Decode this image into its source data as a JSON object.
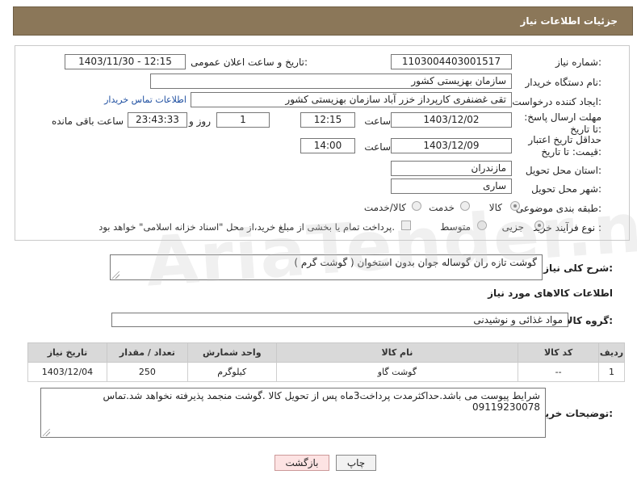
{
  "header": {
    "title": "جزئیات اطلاعات نیاز"
  },
  "form": {
    "need_number_label": "شماره نیاز:",
    "need_number": "1103004403001517",
    "announce_label": "تاریخ و ساعت اعلان عمومی:",
    "announce_value": "1403/11/30 - 12:15",
    "buyer_org_label": "نام دستگاه خریدار:",
    "buyer_org": "سازمان بهزیستی کشور",
    "requester_label": "ایجاد کننده درخواست:",
    "requester": "تقی غضنفری کارپرداز خزر آباد سازمان بهزیستی کشور",
    "contact_link": "اطلاعات تماس خریدار",
    "deadline_label": "مهلت ارسال پاسخ: تا تاریخ:",
    "deadline_date": "1403/12/02",
    "time_label": "ساعت",
    "deadline_time": "12:15",
    "days_value": "1",
    "days_label": "روز و",
    "remaining_time": "23:43:33",
    "remaining_label": "ساعت باقی مانده",
    "validity_label": "حداقل تاریخ اعتبار قیمت: تا تاریخ:",
    "validity_date": "1403/12/09",
    "validity_time": "14:00",
    "province_label": "استان محل تحویل:",
    "province": "مازندران",
    "city_label": "شهر محل تحویل:",
    "city": "ساری",
    "category_label": "طبقه بندی موضوعی:",
    "category_options": [
      "کالا",
      "خدمت",
      "کالا/خدمت"
    ],
    "process_label": "نوع فرآیند خرید :",
    "process_options": [
      "جزیی",
      "متوسط"
    ],
    "payment_note": "پرداخت تمام یا بخشی از مبلغ خرید،از محل \"اسناد خزانه اسلامی\" خواهد بود."
  },
  "summary": {
    "label": "شرح کلی نیاز:",
    "text": "گوشت تازه ران گوساله جوان بدون استخوان ( گوشت گرم )"
  },
  "goods": {
    "section_title": "اطلاعات کالاهای مورد نیاز",
    "group_label": "گروه کالا:",
    "group_value": "مواد غذائی و نوشیدنی",
    "table": {
      "headers": [
        "ردیف",
        "کد کالا",
        "نام کالا",
        "واحد شمارش",
        "تعداد / مقدار",
        "تاریخ نیاز"
      ],
      "rows": [
        [
          "1",
          "--",
          "گوشت گاو",
          "کیلوگرم",
          "250",
          "1403/12/04"
        ]
      ]
    }
  },
  "buyer_notes": {
    "label": "توضیحات خریدار:",
    "text": "شرایط پیوست می باشد.حداکثرمدت پرداخت3ماه پس از تحویل کالا .گوشت منجمد پذیرفته نخواهد شد.تماس 09119230078"
  },
  "buttons": {
    "print": "چاپ",
    "back": "بازگشت"
  },
  "watermark": {
    "text": "AriaTender.neT"
  }
}
